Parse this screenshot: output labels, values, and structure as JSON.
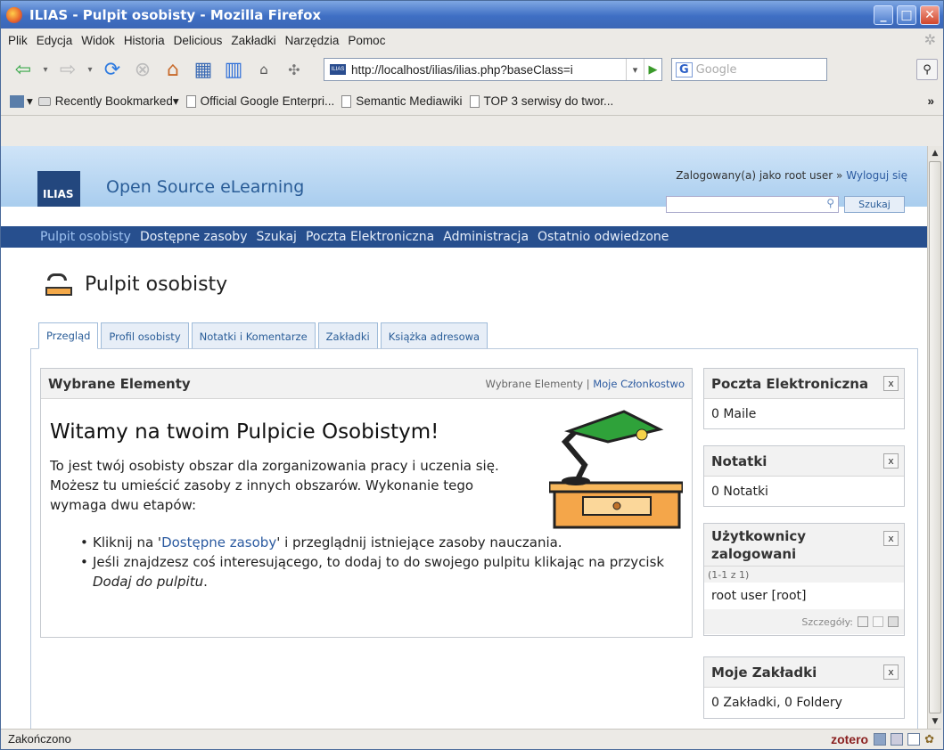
{
  "window": {
    "title": "ILIAS - Pulpit osobisty - Mozilla Firefox"
  },
  "menu": [
    "Plik",
    "Edycja",
    "Widok",
    "Historia",
    "Delicious",
    "Zakładki",
    "Narzędzia",
    "Pomoc"
  ],
  "nav": {
    "url": "http://localhost/ilias/ilias.php?baseClass=i",
    "search_placeholder": "Google",
    "favicon": "ILIAS"
  },
  "bookmarks": [
    "Recently Bookmarked",
    "Official Google Enterpri...",
    "Semantic Mediawiki",
    "TOP 3 serwisy do twor...",
    "»"
  ],
  "page": {
    "logo": "ILIAS",
    "brand": "Open Source eLearning",
    "logged_in_prefix": "Zalogowany(a) jako root user »",
    "logout": "Wyloguj się",
    "search_button": "Szukaj",
    "main_nav": [
      "Pulpit osobisty",
      "Dostępne zasoby",
      "Szukaj",
      "Poczta Elektroniczna",
      "Administracja",
      "Ostatnio odwiedzone"
    ],
    "title": "Pulpit osobisty",
    "tabs": [
      "Przegląd",
      "Profil osobisty",
      "Notatki i Komentarze",
      "Zakładki",
      "Książka adresowa"
    ],
    "featured": {
      "title": "Wybrane Elementy",
      "opt1": "Wybrane Elementy",
      "sep": "|",
      "opt2": "Moje Członkostwo",
      "welcome": "Witamy na twoim Pulpicie Osobistym!",
      "intro": "To jest twój osobisty obszar dla zorganizowania pracy i uczenia się. Możesz tu umieścić zasoby z innych obszarów. Wykonanie tego wymaga dwu etapów:",
      "b1_pre": "Kliknij na '",
      "b1_link": "Dostępne zasoby",
      "b1_post": "' i przeglądnij istniejące zasoby nauczania.",
      "b2_pre": "Jeśli znajdzesz coś interesującego, to dodaj to do swojego pulpitu klikając na przycisk ",
      "b2_em": "Dodaj do pulpitu",
      "b2_post": "."
    },
    "side": {
      "mail_title": "Poczta Elektroniczna",
      "mail_body": "0 Maile",
      "notes_title": "Notatki",
      "notes_body": "0 Notatki",
      "users_title": "Użytkownicy zalogowani",
      "users_range": "(1-1 z 1)",
      "users_body": "root user [root]",
      "users_details": "Szczegóły:",
      "bm_title": "Moje Zakładki",
      "bm_body": "0 Zakładki, 0 Foldery",
      "close": "x"
    }
  },
  "status": {
    "text": "Zakończono",
    "zotero": "zotero"
  }
}
